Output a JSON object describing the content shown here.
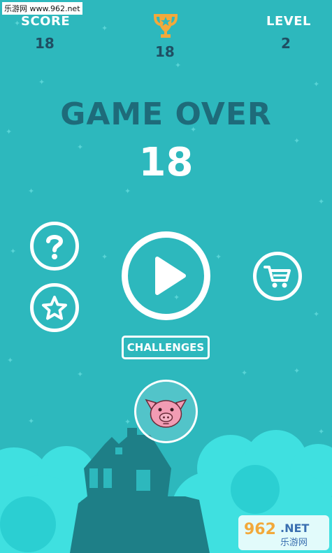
{
  "watermark": {
    "top_left": "乐游网 www.962.net"
  },
  "hud": {
    "score_label": "SCORE",
    "score_value": "18",
    "best_value": "18",
    "level_label": "LEVEL",
    "level_value": "2"
  },
  "main": {
    "title": "GAME OVER",
    "score": "18",
    "challenges_label": "CHALLENGES"
  },
  "icons": {
    "trophy": "trophy-icon",
    "help": "question-icon",
    "rate": "star-icon",
    "play": "play-icon",
    "shop": "cart-icon",
    "character": "pig-icon"
  },
  "colors": {
    "background": "#2db8bd",
    "title": "#1e6b7a",
    "hud_value": "#1f4f63",
    "trophy": "#f2a93b",
    "clouds": "#3fe0e0",
    "house": "#1e7f87",
    "pig": "#f29cb4"
  }
}
